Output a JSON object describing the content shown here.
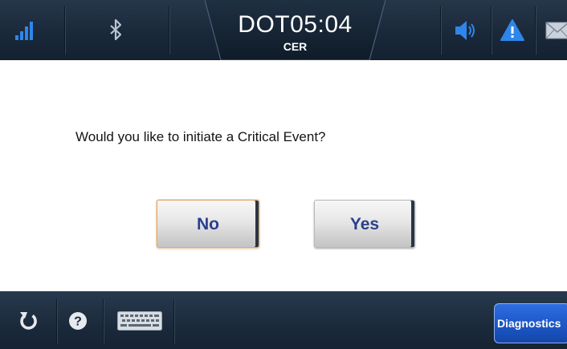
{
  "header": {
    "time": "DOT05:04",
    "subtitle": "CER",
    "icons": [
      "signal-bars-icon",
      "bluetooth-icon",
      "speaker-icon",
      "warning-icon",
      "envelope-icon"
    ]
  },
  "dialog": {
    "question": "Would you like to initiate a Critical Event?",
    "no_label": "No",
    "yes_label": "Yes"
  },
  "footer": {
    "icons": [
      "refresh-icon",
      "help-icon",
      "keyboard-icon"
    ],
    "diagnostics_label": "Diagnostics"
  },
  "colors": {
    "bar_bg": "#1b2a3b",
    "button_text": "#2b3f8e",
    "accent_blue": "#1f5acb",
    "signal_blue": "#2f86ea"
  }
}
